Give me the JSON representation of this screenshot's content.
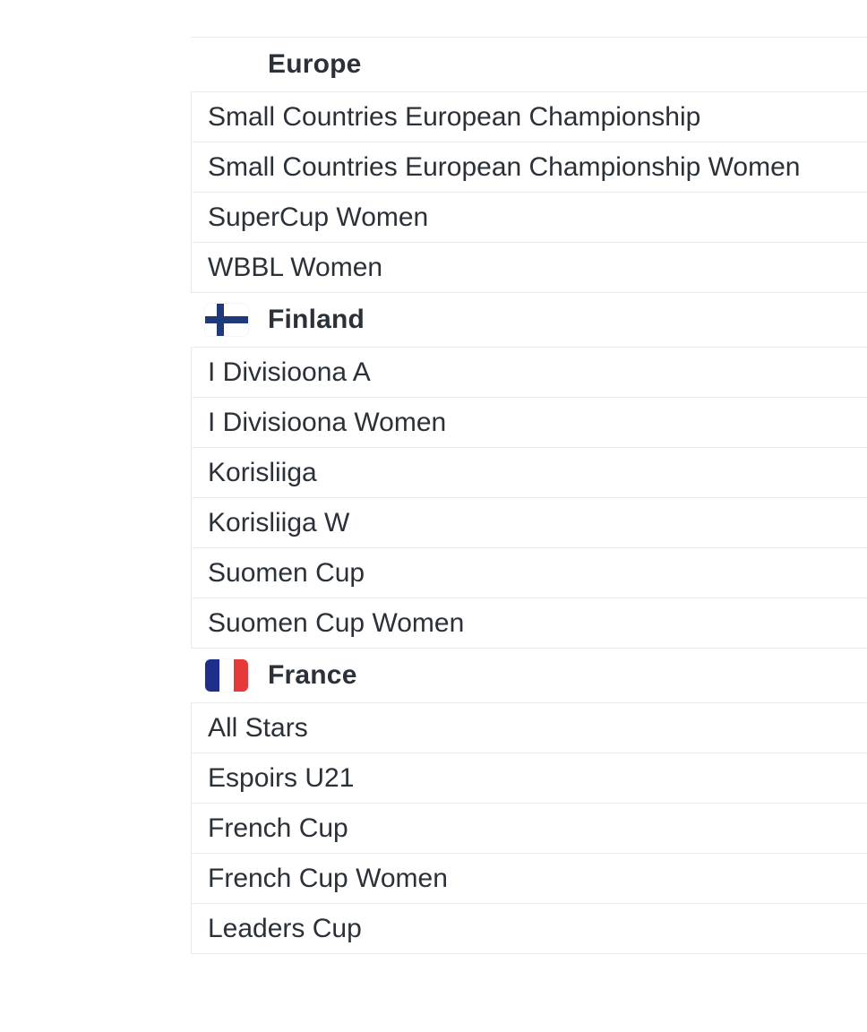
{
  "groups": [
    {
      "name": "Europe",
      "flag": "none",
      "items": [
        "Small Countries European Championship",
        "Small Countries European Championship Women",
        "SuperCup Women",
        "WBBL Women"
      ]
    },
    {
      "name": "Finland",
      "flag": "finland-flag",
      "items": [
        "I Divisioona A",
        "I Divisioona Women",
        "Korisliiga",
        "Korisliiga W",
        "Suomen Cup",
        "Suomen Cup Women"
      ]
    },
    {
      "name": "France",
      "flag": "france-flag",
      "items": [
        "All Stars",
        "Espoirs U21",
        "French Cup",
        "French Cup Women",
        "Leaders Cup"
      ]
    }
  ],
  "colors": {
    "text": "#2b3139",
    "border": "#e8eaed",
    "finland_blue": "#1f3a7a",
    "france_blue": "#1e2f8a",
    "france_red": "#e63a3a"
  }
}
